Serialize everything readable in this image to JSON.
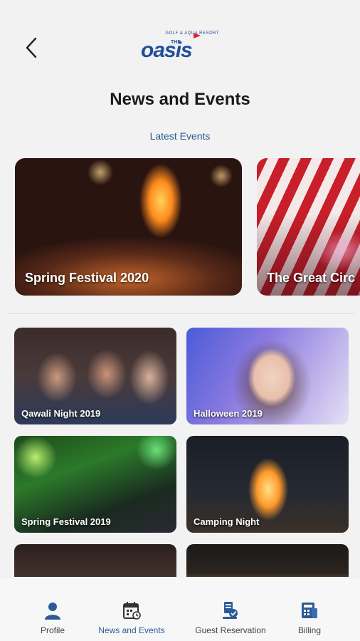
{
  "header": {
    "logo": {
      "top_text": "GOLF & AQUA RESORT",
      "the": "THE",
      "name": "oasis"
    }
  },
  "page_title": "News and Events",
  "section_label": "Latest Events",
  "featured_events": [
    {
      "label": "Spring Festival 2020"
    },
    {
      "label": "The Great Circ"
    }
  ],
  "events": [
    {
      "label": "Qawali Night 2019"
    },
    {
      "label": "Halloween 2019"
    },
    {
      "label": "Spring Festival 2019"
    },
    {
      "label": "Camping Night"
    },
    {
      "label": ""
    },
    {
      "label": ""
    }
  ],
  "tabbar": {
    "items": [
      {
        "label": "Profile",
        "icon": "person-icon"
      },
      {
        "label": "News and Events",
        "icon": "calendar-icon"
      },
      {
        "label": "Guest Reservation",
        "icon": "reservation-icon"
      },
      {
        "label": "Billing",
        "icon": "billing-icon"
      }
    ],
    "active_index": 1,
    "active_color": "#2b5a97",
    "icon_color": "#2b5a97"
  },
  "colors": {
    "brand": "#1f4f9c",
    "background": "#f2f2f2"
  }
}
